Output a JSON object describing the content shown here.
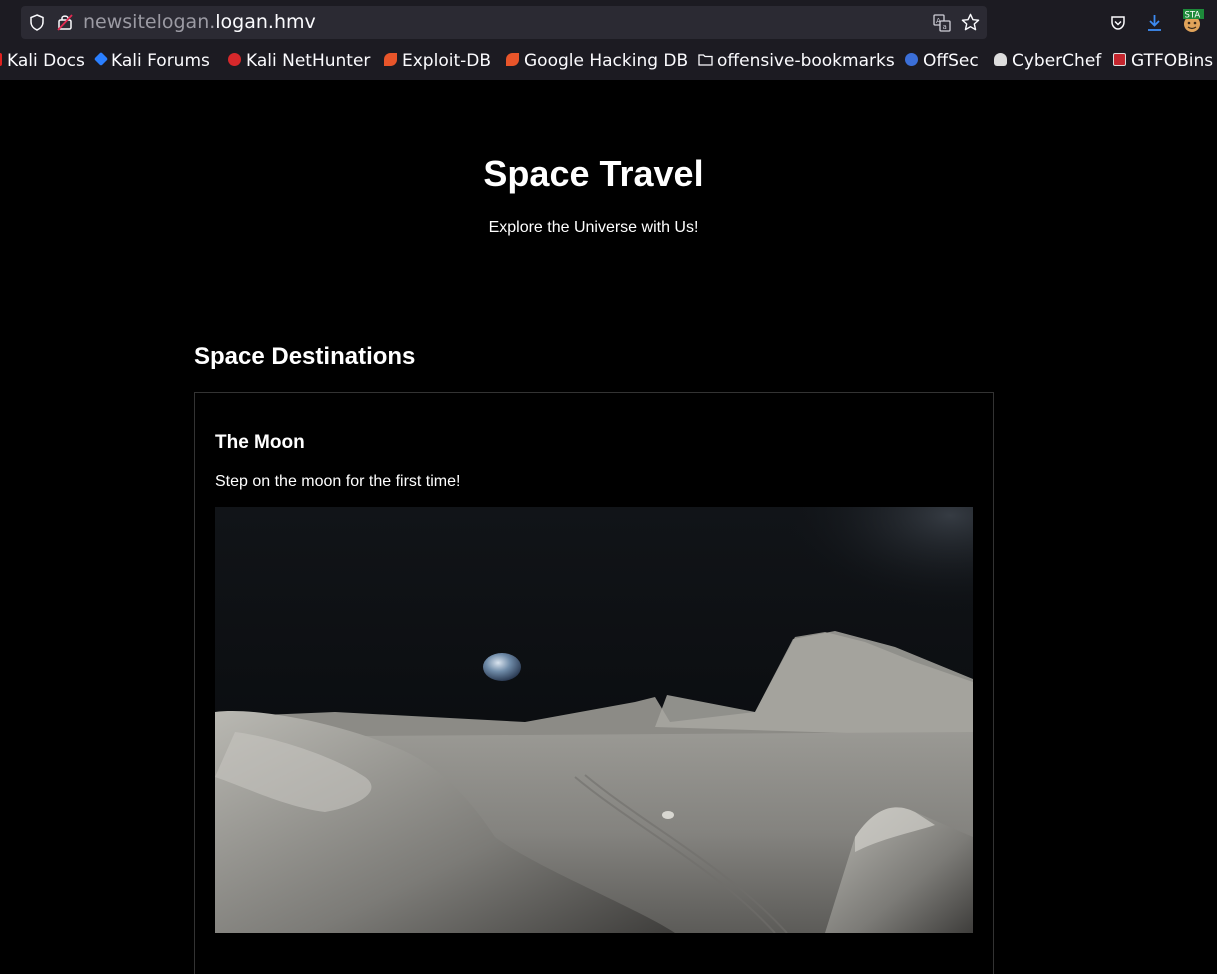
{
  "browser": {
    "url_domain_dim": "newsitelogan.",
    "url_domain_main": "logan.hmv",
    "extension_badge": "STA"
  },
  "bookmarks": [
    {
      "label": "Kali Docs",
      "icon": "kali-docs-icon",
      "color": "#e0211f"
    },
    {
      "label": "Kali Forums",
      "icon": "kali-forums-icon",
      "color": "#2a7fff"
    },
    {
      "label": "Kali NetHunter",
      "icon": "kali-nethunter-icon",
      "color": "#d6282b"
    },
    {
      "label": "Exploit-DB",
      "icon": "exploit-db-icon",
      "color": "#e8552a"
    },
    {
      "label": "Google Hacking DB",
      "icon": "ghdb-icon",
      "color": "#e8552a"
    },
    {
      "label": "offensive-bookmarks",
      "icon": "folder-icon",
      "color": "#fbfbfe"
    },
    {
      "label": "OffSec",
      "icon": "offsec-icon",
      "color": "#3b6fd8"
    },
    {
      "label": "CyberChef",
      "icon": "cyberchef-icon",
      "color": "#dddddd"
    },
    {
      "label": "GTFOBins",
      "icon": "gtfobins-icon",
      "color": "#c4262e"
    }
  ],
  "site": {
    "title": "Space Travel",
    "tagline": "Explore the Universe with Us!"
  },
  "destinations_section": {
    "heading": "Space Destinations",
    "cards": [
      {
        "title": "The Moon",
        "description": "Step on the moon for the first time!",
        "image": "moon-surface-with-earthrise"
      }
    ]
  }
}
